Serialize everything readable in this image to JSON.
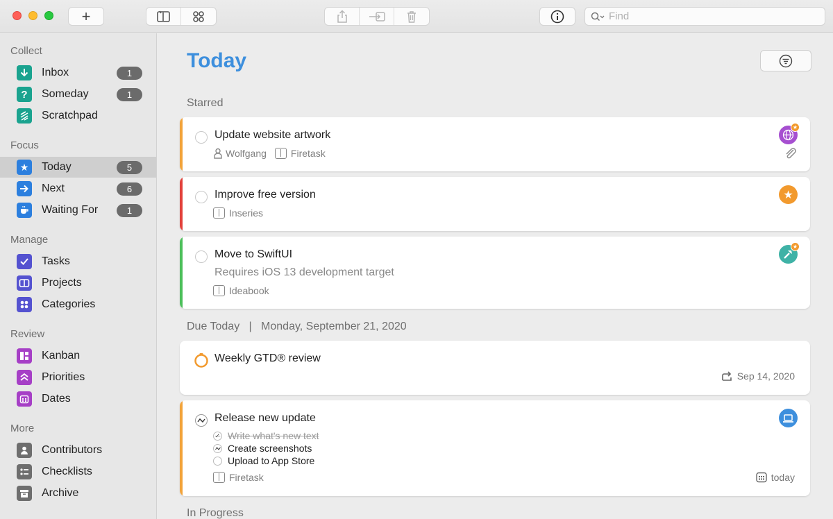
{
  "toolbar": {
    "add_label": "+",
    "search_placeholder": "Find"
  },
  "sidebar": {
    "sections": [
      {
        "title": "Collect",
        "items": [
          {
            "label": "Inbox",
            "badge": "1",
            "icon": "inbox-icon",
            "color": "#1aa38f"
          },
          {
            "label": "Someday",
            "badge": "1",
            "icon": "question-icon",
            "color": "#1aa38f"
          },
          {
            "label": "Scratchpad",
            "badge": "",
            "icon": "scratchpad-icon",
            "color": "#1aa38f"
          }
        ]
      },
      {
        "title": "Focus",
        "items": [
          {
            "label": "Today",
            "badge": "5",
            "icon": "star-icon",
            "color": "#2c7fde"
          },
          {
            "label": "Next",
            "badge": "6",
            "icon": "arrow-right-icon",
            "color": "#2c7fde"
          },
          {
            "label": "Waiting For",
            "badge": "1",
            "icon": "coffee-icon",
            "color": "#2c7fde"
          }
        ]
      },
      {
        "title": "Manage",
        "items": [
          {
            "label": "Tasks",
            "badge": "",
            "icon": "checkmark-icon",
            "color": "#5452d0"
          },
          {
            "label": "Projects",
            "badge": "",
            "icon": "project-icon",
            "color": "#5452d0"
          },
          {
            "label": "Categories",
            "badge": "",
            "icon": "categories-icon",
            "color": "#5452d0"
          }
        ]
      },
      {
        "title": "Review",
        "items": [
          {
            "label": "Kanban",
            "badge": "",
            "icon": "kanban-icon",
            "color": "#a63fc6"
          },
          {
            "label": "Priorities",
            "badge": "",
            "icon": "priorities-icon",
            "color": "#a63fc6"
          },
          {
            "label": "Dates",
            "badge": "",
            "icon": "calendar-icon",
            "color": "#a63fc6"
          }
        ]
      },
      {
        "title": "More",
        "items": [
          {
            "label": "Contributors",
            "badge": "",
            "icon": "person-icon",
            "color": "#6e6e6e"
          },
          {
            "label": "Checklists",
            "badge": "",
            "icon": "checklist-icon",
            "color": "#6e6e6e"
          },
          {
            "label": "Archive",
            "badge": "",
            "icon": "archive-icon",
            "color": "#6e6e6e"
          }
        ]
      }
    ]
  },
  "main": {
    "title": "Today",
    "groups": {
      "starred": "Starred",
      "due_today": "Due Today",
      "due_date": "Monday, September 21, 2020",
      "separator": "|",
      "in_progress": "In Progress"
    },
    "tasks": [
      {
        "title": "Update website artwork",
        "contributor": "Wolfgang",
        "project": "Firetask",
        "stripe": "#f2a33a",
        "icon_color": "#a64fd0"
      },
      {
        "title": "Improve free version",
        "project": "Inseries",
        "stripe": "#e2413b",
        "icon_color": "#f29a2e"
      },
      {
        "title": "Move to SwiftUI",
        "note": "Requires iOS 13 development target",
        "project": "Ideabook",
        "stripe": "#4cbf5a",
        "icon_color": "#3fb2a6"
      },
      {
        "title": "Weekly GTD® review",
        "repeat_date": "Sep 14, 2020"
      },
      {
        "title": "Release new update",
        "project": "Firetask",
        "due": "today",
        "stripe": "#f2a33a",
        "icon_color": "#3d8fdd",
        "subtasks": [
          {
            "label": "Write what's new text",
            "state": "done"
          },
          {
            "label": "Create screenshots",
            "state": "in-progress"
          },
          {
            "label": "Upload to App Store",
            "state": "open"
          }
        ]
      }
    ]
  }
}
